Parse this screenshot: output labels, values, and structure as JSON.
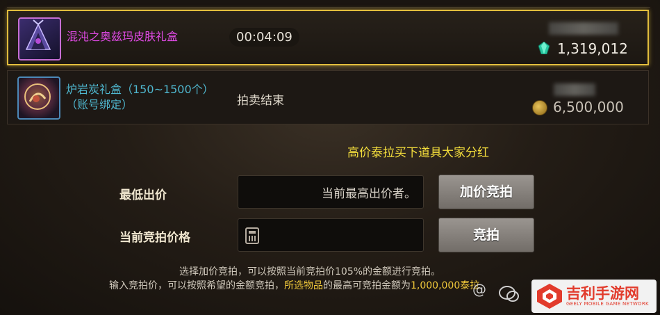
{
  "auction_rows": [
    {
      "name": "混沌之奥兹玛皮肤礼盒",
      "timer": "00:04:09",
      "price": "1,319,012",
      "currency_icon": "teal-gem-icon",
      "status": "active"
    },
    {
      "name_line1": "炉岩炭礼盒（150~1500个）",
      "name_line2": "（账号绑定）",
      "status_text": "拍卖结束",
      "price": "6,500,000",
      "currency_icon": "gold-coin-icon",
      "status": "ended"
    }
  ],
  "overlay_note": "高价泰拉买下道具大家分红",
  "bid_panel": {
    "min_bid_label": "最低出价",
    "min_bid_value": "当前最高出价者。",
    "raise_bid_button": "加价竞拍",
    "current_price_label": "当前竞拍价格",
    "bid_button": "竞拍",
    "calculator_icon": "calculator-icon"
  },
  "info_text": {
    "line1": "选择加价竞拍，可以按照当前竞拍价105%的金额进行竞拍。",
    "line2_prefix": "输入竞拍价，可以按照希望的金额竞拍，",
    "line2_highlight": "所选物品",
    "line2_middle": "的最高可竞拍金额为",
    "line2_amount": "1,000,000泰拉"
  },
  "watermark": {
    "title": "吉利手游网",
    "subtitle": "GEELY MOBILE GAME NETWORK",
    "at_sign": "@"
  },
  "colors": {
    "selected_border": "#e1bd3d",
    "item_name_purple": "#e14ae6",
    "item_name_cyan": "#4fb7cf",
    "note_yellow": "#f4de3c",
    "highlight": "#f0c83a"
  }
}
